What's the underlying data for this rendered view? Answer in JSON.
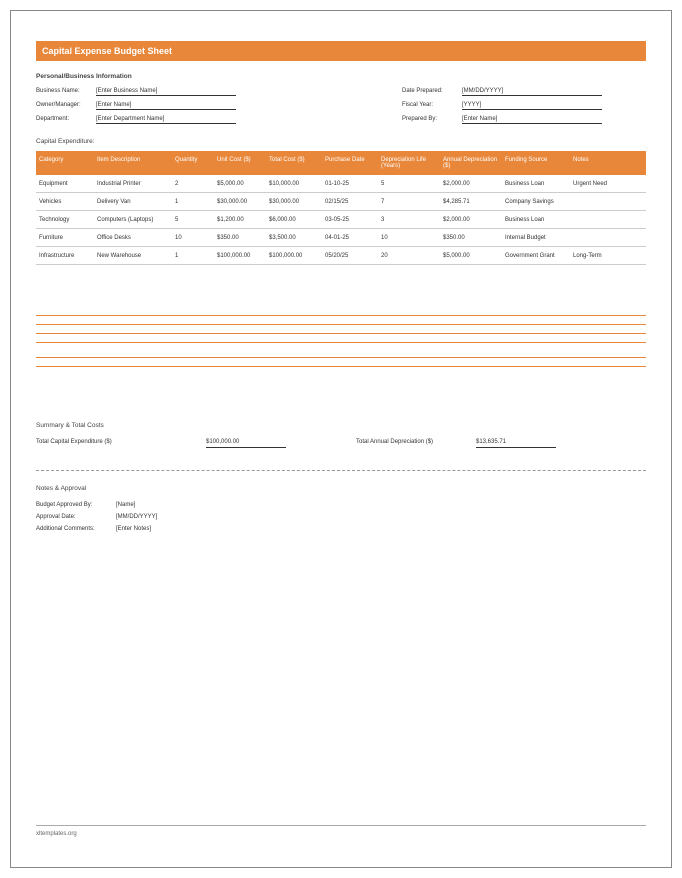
{
  "title": "Capital Expense Budget Sheet",
  "section_personal": "Personal/Business Information",
  "info": {
    "business_name_label": "Business Name:",
    "business_name": "[Enter Business Name]",
    "owner_label": "Owner/Manager:",
    "owner": "[Enter Name]",
    "department_label": "Department:",
    "department": "[Enter Department Name]",
    "date_prepared_label": "Date Prepared:",
    "date_prepared": "[MM/DD/YYYY]",
    "fiscal_year_label": "Fiscal Year:",
    "fiscal_year": "[YYYY]",
    "prepared_by_label": "Prepared By:",
    "prepared_by": "[Enter Name]"
  },
  "section_expenditure": "Capital Expenditure:",
  "headers": {
    "cat": "Category",
    "desc": "Item Description",
    "qty": "Quantity",
    "unit": "Unit Cost ($)",
    "total": "Total Cost ($)",
    "purchase": "Purchase Date",
    "dep_life": "Depreciation Life (Years)",
    "annual_dep": "Annual Depreciation ($)",
    "funding": "Funding Source",
    "notes": "Notes"
  },
  "rows": [
    {
      "cat": "Equipment",
      "desc": "Industrial Printer",
      "qty": "2",
      "unit": "$5,000.00",
      "total": "$10,000.00",
      "purchase": "01-10-25",
      "dep_life": "5",
      "annual_dep": "$2,000.00",
      "funding": "Business Loan",
      "notes": "Urgent Need"
    },
    {
      "cat": "Vehicles",
      "desc": "Delivery Van",
      "qty": "1",
      "unit": "$30,000.00",
      "total": "$30,000.00",
      "purchase": "02/15/25",
      "dep_life": "7",
      "annual_dep": "$4,285.71",
      "funding": "Company Savings",
      "notes": ""
    },
    {
      "cat": "Technology",
      "desc": "Computers (Laptops)",
      "qty": "5",
      "unit": "$1,200.00",
      "total": "$6,000.00",
      "purchase": "03-05-25",
      "dep_life": "3",
      "annual_dep": "$2,000.00",
      "funding": "Business Loan",
      "notes": ""
    },
    {
      "cat": "Furniture",
      "desc": "Office Desks",
      "qty": "10",
      "unit": "$350.00",
      "total": "$3,500.00",
      "purchase": "04-01-25",
      "dep_life": "10",
      "annual_dep": "$350.00",
      "funding": "Internal Budget",
      "notes": ""
    },
    {
      "cat": "Infrastructure",
      "desc": "New Warehouse",
      "qty": "1",
      "unit": "$100,000.00",
      "total": "$100,000.00",
      "purchase": "05/20/25",
      "dep_life": "20",
      "annual_dep": "$5,000.00",
      "funding": "Government Grant",
      "notes": "Long-Term"
    }
  ],
  "summary_heading": "Summary & Total Costs",
  "summary": {
    "total_cap_label": "Total Capital Expenditure ($)",
    "total_cap": "$100,000.00",
    "total_dep_label": "Total Annual Depreciation ($)",
    "total_dep": "$13,635.71"
  },
  "notes_heading": "Notes & Approval",
  "approval": {
    "approved_by_label": "Budget Approved By:",
    "approved_by": "[Name]",
    "approval_date_label": "Approval Date:",
    "approval_date": "[MM/DD/YYYY]",
    "comments_label": "Additional Comments:",
    "comments": "[Enter Notes]"
  },
  "footer": "xltemplates.org"
}
